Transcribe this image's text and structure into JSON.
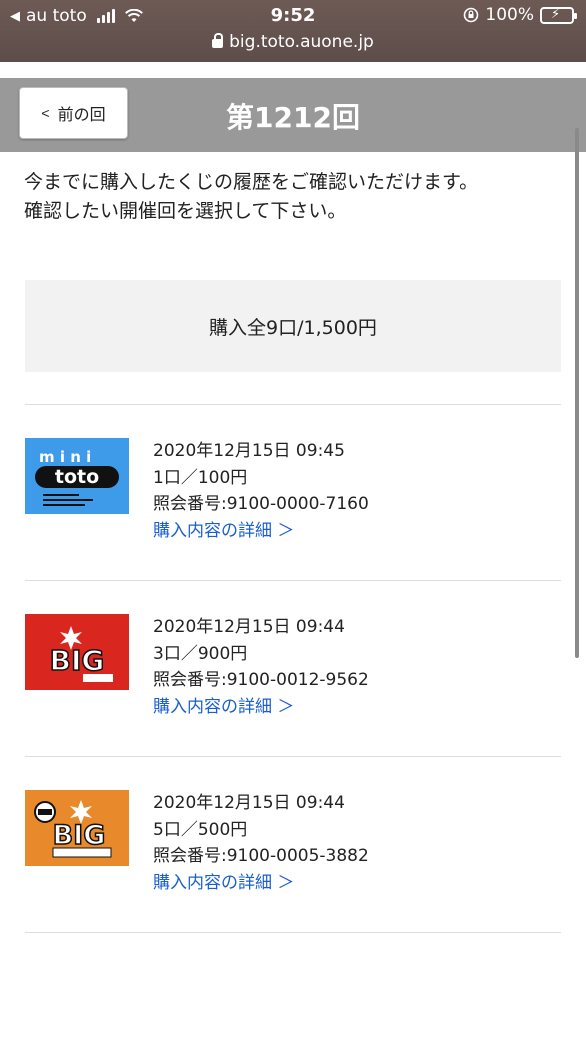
{
  "status_bar": {
    "carrier": "au toto",
    "time": "9:52",
    "battery": "100%",
    "url": "big.toto.auone.jp"
  },
  "header": {
    "back_label": "前の回",
    "title": "第1212回"
  },
  "intro": {
    "line1": "今までに購入したくじの履歴をご確認いただけます。",
    "line2": "確認したい開催回を選択して下さい。"
  },
  "summary": "購入全9口/1,500円",
  "items": [
    {
      "logo": "mini-toto-logo",
      "datetime": "2020年12月15日 09:45",
      "quantity": "1口／100円",
      "reference": "照会番号:9100-0000-7160",
      "detail_label": "購入内容の詳細 ＞",
      "logo_color": "#3d9be9"
    },
    {
      "logo": "big-logo",
      "datetime": "2020年12月15日 09:44",
      "quantity": "3口／900円",
      "reference": "照会番号:9100-0012-9562",
      "detail_label": "購入内容の詳細 ＞",
      "logo_color": "#d9271f"
    },
    {
      "logo": "100yen-big-logo",
      "datetime": "2020年12月15日 09:44",
      "quantity": "5口／500円",
      "reference": "照会番号:9100-0005-3882",
      "detail_label": "購入内容の詳細 ＞",
      "logo_color": "#e88a2c"
    }
  ],
  "colors": {
    "header_bg": "#999999",
    "link": "#1a5fcf",
    "summary_bg": "#f2f2f2"
  }
}
